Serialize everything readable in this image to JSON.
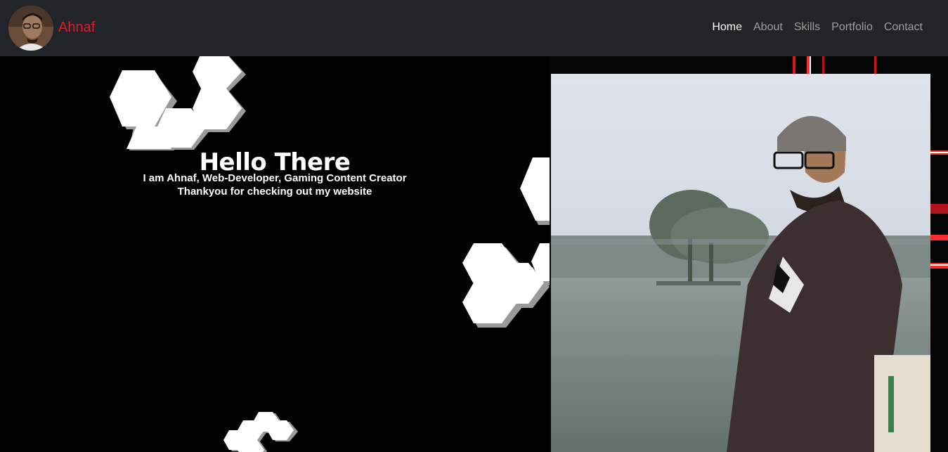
{
  "brand": {
    "name": "Ahnaf",
    "color": "#dc1f26"
  },
  "nav": {
    "items": [
      {
        "label": "Home",
        "active": true
      },
      {
        "label": "About",
        "active": false
      },
      {
        "label": "Skills",
        "active": false
      },
      {
        "label": "Portfolio",
        "active": false
      },
      {
        "label": "Contact",
        "active": false
      }
    ]
  },
  "hero": {
    "heading": "Hello There",
    "line1": "I am Ahnaf, Web-Developer, Gaming Content Creator",
    "line2": "Thankyou for checking out my website"
  },
  "photo": {
    "subject": "portrait-photo"
  },
  "icons": {
    "avatar": "avatar-photo",
    "decor": "hexagon-pattern"
  }
}
